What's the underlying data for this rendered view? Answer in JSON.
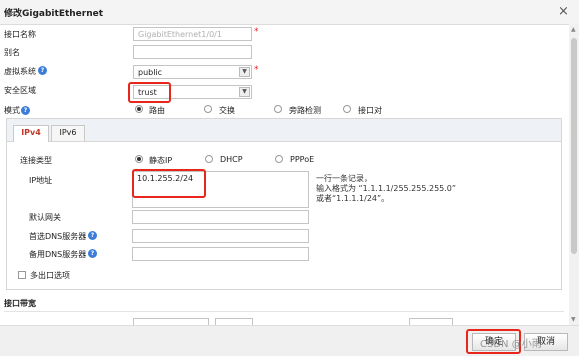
{
  "window": {
    "title": "修改GigabitEthernet",
    "close_glyph": "×"
  },
  "form": {
    "interface_name": {
      "label": "接口名称",
      "value": "GigabitEthernet1/0/1",
      "required": "*"
    },
    "alias": {
      "label": "别名",
      "value": ""
    },
    "virtual_system": {
      "label": "虚拟系统",
      "help": "?",
      "value": "public",
      "required": "*"
    },
    "security_zone": {
      "label": "安全区域",
      "value": "trust"
    },
    "mode": {
      "label": "模式",
      "help": "?",
      "options": [
        "路由",
        "交换",
        "旁路检测",
        "接口对"
      ],
      "selected": "路由"
    }
  },
  "tabs": [
    {
      "label": "IPv4"
    },
    {
      "label": "IPv6"
    }
  ],
  "ipv4": {
    "conn_type": {
      "label": "连接类型",
      "options": [
        "静态IP",
        "DHCP",
        "PPPoE"
      ],
      "selected": "静态IP"
    },
    "ip": {
      "label": "IP地址",
      "value": "10.1.255.2/24",
      "hint": [
        "一行一条记录，",
        "输入格式为 “1.1.1.1/255.255.255.0”",
        "或者“1.1.1.1/24”。"
      ]
    },
    "gateway": {
      "label": "默认网关",
      "value": ""
    },
    "dns1": {
      "label": "首选DNS服务器",
      "help": "?",
      "value": ""
    },
    "dns2": {
      "label": "备用DNS服务器",
      "help": "?",
      "value": ""
    },
    "multi_egress": {
      "label": "多出口选项"
    }
  },
  "bandwidth": {
    "title": "接口带宽"
  },
  "footer": {
    "ok_label": "确定",
    "cancel_label": "取消",
    "watermark": "CSDN @小雨"
  },
  "colors": {
    "highlight": "#e8261b",
    "help": "#3b7dd8",
    "active_tab": "#c0392b"
  }
}
